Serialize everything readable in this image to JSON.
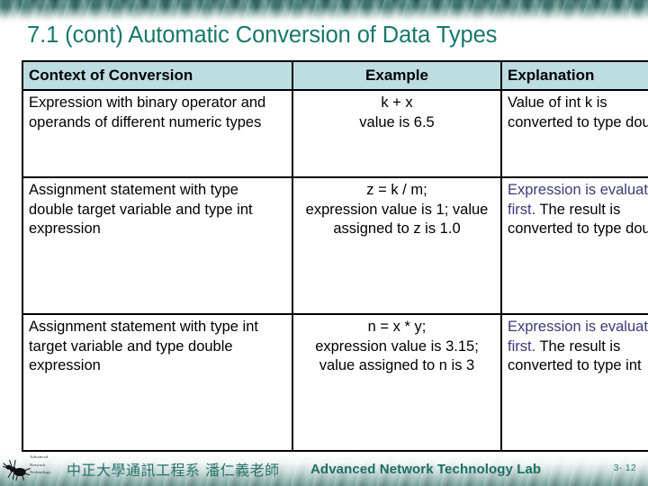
{
  "slide": {
    "title": "7.1 (cont) Automatic Conversion of Data Types",
    "title_color": "#17786b",
    "page_number": "3- 12"
  },
  "table": {
    "header_bg": "#bedde2",
    "accent_color": "#3b3b78",
    "columns": [
      {
        "key": "context",
        "label": "Context of Conversion"
      },
      {
        "key": "example",
        "label": "Example"
      },
      {
        "key": "explanation",
        "label": "Explanation"
      }
    ],
    "rows": [
      {
        "context": "Expression with binary operator and operands of different numeric types",
        "example_line1": "k + x",
        "example_line2": "value is 6.5",
        "explanation_accent": "",
        "explanation_plain": "Value of int k is converted to type double"
      },
      {
        "context": "Assignment statement with type double target variable and type int expression",
        "example_line1": "z = k / m;",
        "example_line2": "expression value is 1; value assigned to z is 1.0",
        "explanation_accent": "Expression is evaluated first.",
        "explanation_plain": "The result is converted to type double"
      },
      {
        "context": "Assignment statement with type int target variable and type double expression",
        "example_line1": "n = x * y;",
        "example_line2": "expression value is 3.15; value assigned to n is 3",
        "explanation_accent": "Expression is evaluated first.",
        "explanation_plain": "The result is converted to type int"
      }
    ]
  },
  "footer": {
    "logo_line1": "Advanced",
    "logo_line2": "Network",
    "logo_line3": "Technology",
    "chinese_text": "中正大學通訊工程系 潘仁義老師",
    "lab_name": "Advanced Network Technology Lab",
    "text_color": "#27706a"
  }
}
